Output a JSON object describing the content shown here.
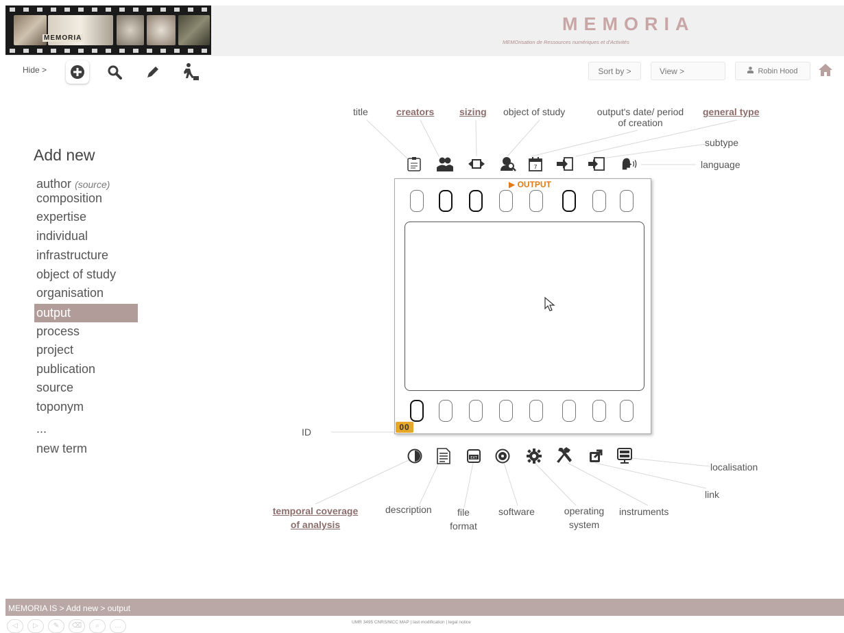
{
  "header": {
    "logo_text": "MEMORIA",
    "brand_title": "MEMORIA",
    "brand_subtitle": "MEMOrisation de Ressources numériques et d'Activités"
  },
  "toolbar": {
    "hide_label": "Hide >",
    "sort_label": "Sort by >",
    "view_label": "View >",
    "user_name": "Robin Hood",
    "icons": [
      "add-icon",
      "search-icon",
      "edit-icon",
      "work-icon",
      "home-icon"
    ]
  },
  "sidebar": {
    "title": "Add new",
    "items": [
      {
        "label": "author",
        "suffix": "(source)"
      },
      {
        "label": "composition"
      },
      {
        "label": "expertise"
      },
      {
        "label": "individual"
      },
      {
        "label": "infrastructure"
      },
      {
        "label": "object of study"
      },
      {
        "label": "organisation"
      },
      {
        "label": "output",
        "active": true
      },
      {
        "label": "process"
      },
      {
        "label": "project"
      },
      {
        "label": "publication"
      },
      {
        "label": "source"
      },
      {
        "label": "toponym"
      },
      {
        "label": "..."
      },
      {
        "label": "new term"
      }
    ]
  },
  "form": {
    "output_tag": "▶ OUTPUT",
    "id_badge": "00",
    "labels": {
      "title": "title",
      "creators": "creators",
      "sizing": "sizing",
      "object_of_study": "object of study",
      "date_line1": "output's date/ period",
      "date_line2": "of creation",
      "general_type": "general type",
      "subtype": "subtype",
      "language": "language",
      "id": "ID",
      "temporal_line1": "temporal coverage",
      "temporal_line2": "of analysis",
      "description": "description",
      "file_line1": "file",
      "file_line2": "format",
      "software": "software",
      "os_line1": "operating",
      "os_line2": "system",
      "instruments": "instruments",
      "link": "link",
      "localisation": "localisation"
    }
  },
  "footer": {
    "breadcrumb": "MEMORIA IS > Add new > output",
    "credits": "UMR 3495 CNRS/MCC MAP    |    last modification    |    legal notice"
  }
}
